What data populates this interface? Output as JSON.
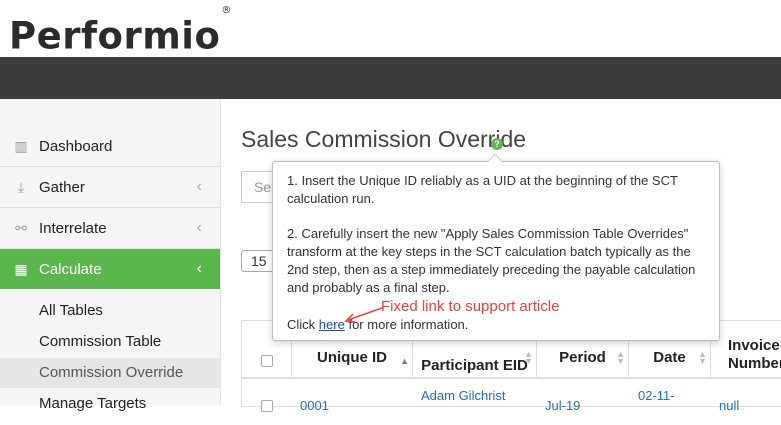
{
  "app": {
    "logo": "Performio",
    "logo_mark": "®"
  },
  "sidebar": {
    "items": [
      {
        "label": "Dashboard",
        "icon": "bar-chart-icon"
      },
      {
        "label": "Gather",
        "icon": "download-icon"
      },
      {
        "label": "Interrelate",
        "icon": "link-icon"
      },
      {
        "label": "Calculate",
        "icon": "table-icon"
      }
    ],
    "chevron": "‹",
    "sub_items": [
      {
        "label": "All Tables"
      },
      {
        "label": "Commission Table"
      },
      {
        "label": "Commission Override"
      },
      {
        "label": "Manage Targets"
      }
    ]
  },
  "page": {
    "title": "Sales Commission Override",
    "help_glyph": "?"
  },
  "search": {
    "placeholder": "Sea"
  },
  "pagination": {
    "page_size": "15"
  },
  "table": {
    "headers": [
      "Unique ID",
      "Participant EID",
      "Period",
      "Date",
      "Invoice Number"
    ],
    "row": [
      "0001",
      "Adam Gilchrist",
      "Jul-19",
      "02-11-",
      "null"
    ]
  },
  "popover": {
    "step1": "1. Insert the Unique ID reliably as a UID at the beginning of the SCT calculation run.",
    "step2": "2. Carefully insert the new \"Apply Sales Commission Table Overrides\" transform at the key steps in the SCT calculation batch typically as the 2nd step, then as a step immediately preceding the payable calculation and probably as a final step.",
    "click_prefix": "Click",
    "link_text": "here",
    "click_suffix": "for more information."
  },
  "annotation": {
    "text": "Fixed link to support article",
    "color": "#e5423b"
  },
  "colors": {
    "accent": "#5cb64e",
    "topbar": "#3c3c3c",
    "link": "#2a6db5"
  }
}
